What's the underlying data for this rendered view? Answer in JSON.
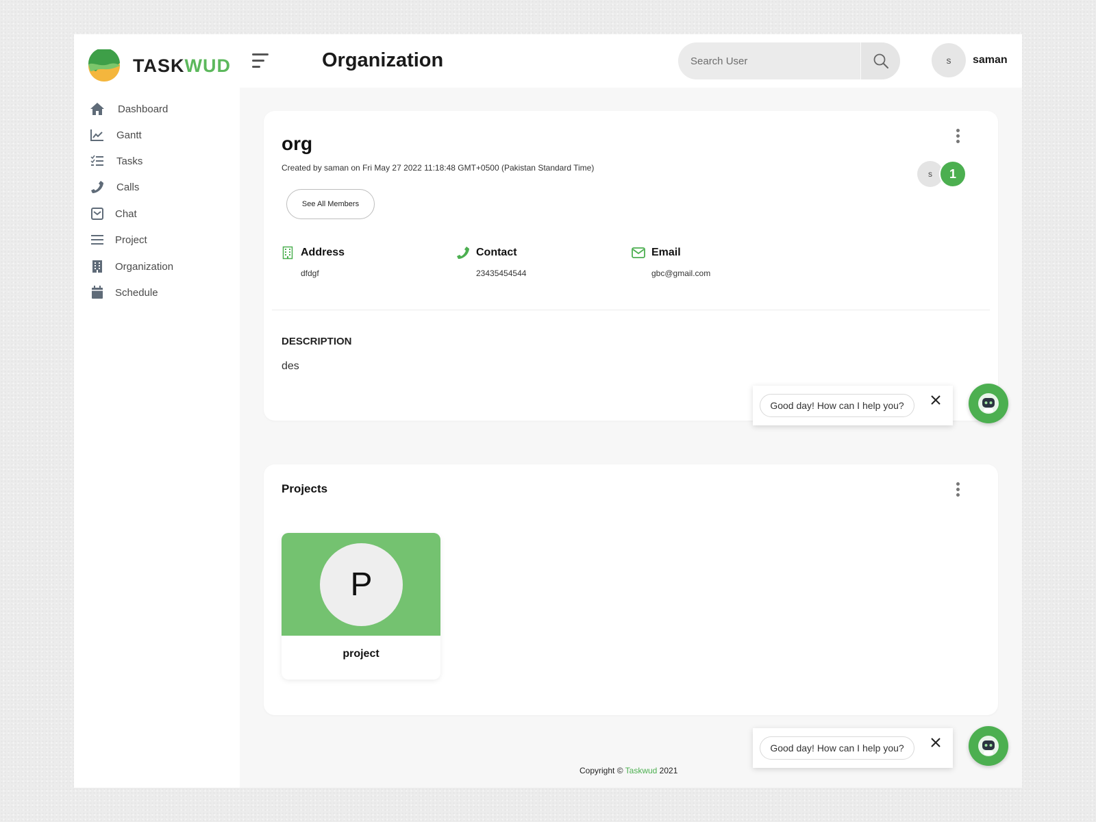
{
  "brand": {
    "logo_text_part1": "TASK",
    "logo_text_part2": "WUD",
    "accent_color": "#5cb85c"
  },
  "header": {
    "page_title": "Organization",
    "search_placeholder": "Search User",
    "user_initial": "s",
    "user_name": "saman"
  },
  "sidebar": {
    "items": [
      {
        "label": "Dashboard",
        "icon": "home-icon"
      },
      {
        "label": "Gantt",
        "icon": "chart-line-icon"
      },
      {
        "label": "Tasks",
        "icon": "tasks-icon"
      },
      {
        "label": "Calls",
        "icon": "phone-icon"
      },
      {
        "label": "Chat",
        "icon": "envelope-icon"
      },
      {
        "label": "Project",
        "icon": "list-icon"
      },
      {
        "label": "Organization",
        "icon": "building-icon"
      },
      {
        "label": "Schedule",
        "icon": "calendar-icon"
      }
    ]
  },
  "organization": {
    "name": "org",
    "created_text": "Created by saman on Fri May 27 2022 11:18:48 GMT+0500 (Pakistan Standard Time)",
    "see_all_label": "See All Members",
    "member_initial": "s",
    "member_count": "1",
    "address_label": "Address",
    "address_value": "dfdgf",
    "contact_label": "Contact",
    "contact_value": "23435454544",
    "email_label": "Email",
    "email_value": "gbc@gmail.com",
    "description_label": "DESCRIPTION",
    "description_value": "des"
  },
  "projects": {
    "title": "Projects",
    "items": [
      {
        "initial": "P",
        "name": "project"
      }
    ]
  },
  "chatbot": {
    "greeting": "Good day! How can I help you?"
  },
  "footer": {
    "prefix": "Copyright © ",
    "brand": "Taskwud",
    "suffix": " 2021"
  }
}
